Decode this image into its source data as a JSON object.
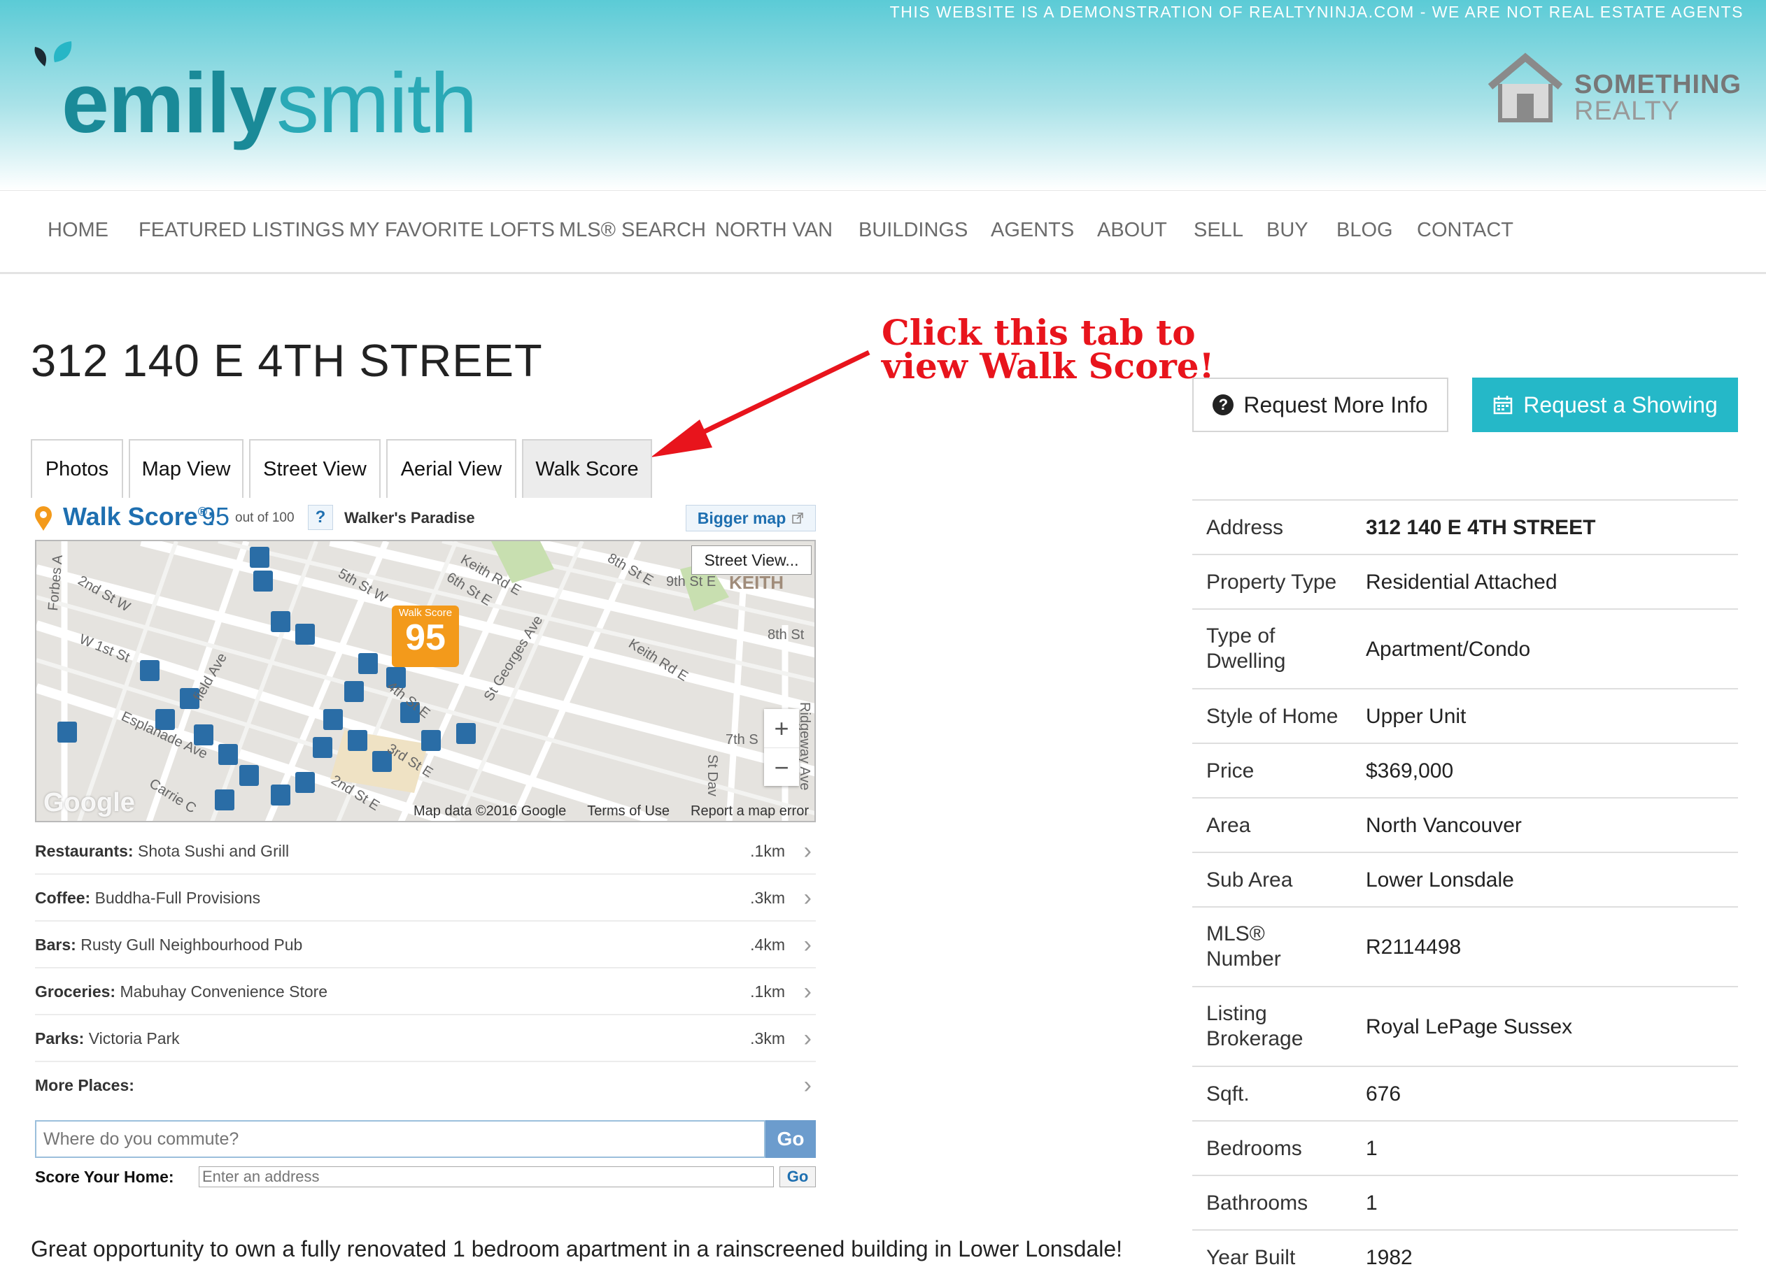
{
  "header": {
    "demo_banner": "THIS WEBSITE IS A DEMONSTRATION OF REALTYNINJA.COM - WE ARE NOT REAL ESTATE AGENTS",
    "logo_bold": "emily",
    "logo_light": "smith",
    "brokerage_line1": "SOMETHING",
    "brokerage_line2": "REALTY"
  },
  "nav": [
    "HOME",
    "FEATURED LISTINGS",
    "MY FAVORITE LOFTS",
    "MLS® SEARCH",
    "NORTH VAN",
    "BUILDINGS",
    "AGENTS",
    "ABOUT",
    "SELL",
    "BUY",
    "BLOG",
    "CONTACT"
  ],
  "listing": {
    "title": "312 140 E 4TH STREET",
    "annotation_line1": "Click this tab to",
    "annotation_line2": "view Walk Score!",
    "request_info": "Request More Info",
    "request_showing": "Request a Showing",
    "tabs": [
      "Photos",
      "Map View",
      "Street View",
      "Aerial View",
      "Walk Score"
    ],
    "active_tab": "Walk Score",
    "description": "Great opportunity to own a fully renovated 1 bedroom apartment in a rainscreened building in Lower Lonsdale!"
  },
  "walkscore": {
    "label": "Walk Score",
    "reg": "®",
    "colon": ":",
    "score": "95",
    "out_of": "out of 100",
    "help": "?",
    "description": "Walker's Paradise",
    "bigger_map": "Bigger map",
    "map": {
      "street_view": "Street View...",
      "marker_label": "Walk Score",
      "marker_score": "95",
      "attribution": "Map data ©2016 Google",
      "terms": "Terms of Use",
      "report": "Report a map error",
      "google": "Google",
      "zoom_in": "+",
      "zoom_out": "−",
      "street_labels": [
        "2nd St W",
        "W 1st St",
        "Esplanade Ave",
        "Forbes A",
        "5th St W",
        "6th St E",
        "Keith Rd E",
        "8th St E",
        "9th St E",
        "KEITH",
        "8th St",
        "Keith Rd E",
        "St Georges Ave",
        "4th St E",
        "3rd St E",
        "2nd St E",
        "7th S",
        "St Dav",
        "Ridgeway Ave",
        "Carrie C",
        "field Ave"
      ]
    },
    "places": [
      {
        "category": "Restaurants:",
        "name": "Shota Sushi and Grill",
        "distance": ".1km"
      },
      {
        "category": "Coffee:",
        "name": "Buddha-Full Provisions",
        "distance": ".3km"
      },
      {
        "category": "Bars:",
        "name": "Rusty Gull Neighbourhood Pub",
        "distance": ".4km"
      },
      {
        "category": "Groceries:",
        "name": "Mabuhay Convenience Store",
        "distance": ".1km"
      },
      {
        "category": "Parks:",
        "name": "Victoria Park",
        "distance": ".3km"
      },
      {
        "category": "More Places:",
        "name": "",
        "distance": ""
      }
    ],
    "commute_placeholder": "Where do you commute?",
    "go": "Go",
    "score_home_label": "Score Your Home:",
    "score_home_placeholder": "Enter an address",
    "go_small": "Go"
  },
  "details": [
    {
      "label": "Address",
      "value": "312 140 E 4TH STREET",
      "bold": true
    },
    {
      "label": "Property Type",
      "value": "Residential Attached"
    },
    {
      "label": "Type of Dwelling",
      "value": "Apartment/Condo"
    },
    {
      "label": "Style of Home",
      "value": "Upper Unit"
    },
    {
      "label": "Price",
      "value": "$369,000"
    },
    {
      "label": "Area",
      "value": "North Vancouver"
    },
    {
      "label": "Sub Area",
      "value": "Lower Lonsdale"
    },
    {
      "label": "MLS® Number",
      "value": "R2114498"
    },
    {
      "label": "Listing Brokerage",
      "value": "Royal LePage Sussex"
    },
    {
      "label": "Sqft.",
      "value": "676"
    },
    {
      "label": "Bedrooms",
      "value": "1"
    },
    {
      "label": "Bathrooms",
      "value": "1"
    },
    {
      "label": "Year Built",
      "value": "1982"
    }
  ],
  "colors": {
    "accent": "#25b8c8",
    "logo": "#1b8b9a",
    "annotation": "#e8141c",
    "walkscore_blue": "#1e6fb0",
    "walkscore_orange": "#f39a1b"
  }
}
